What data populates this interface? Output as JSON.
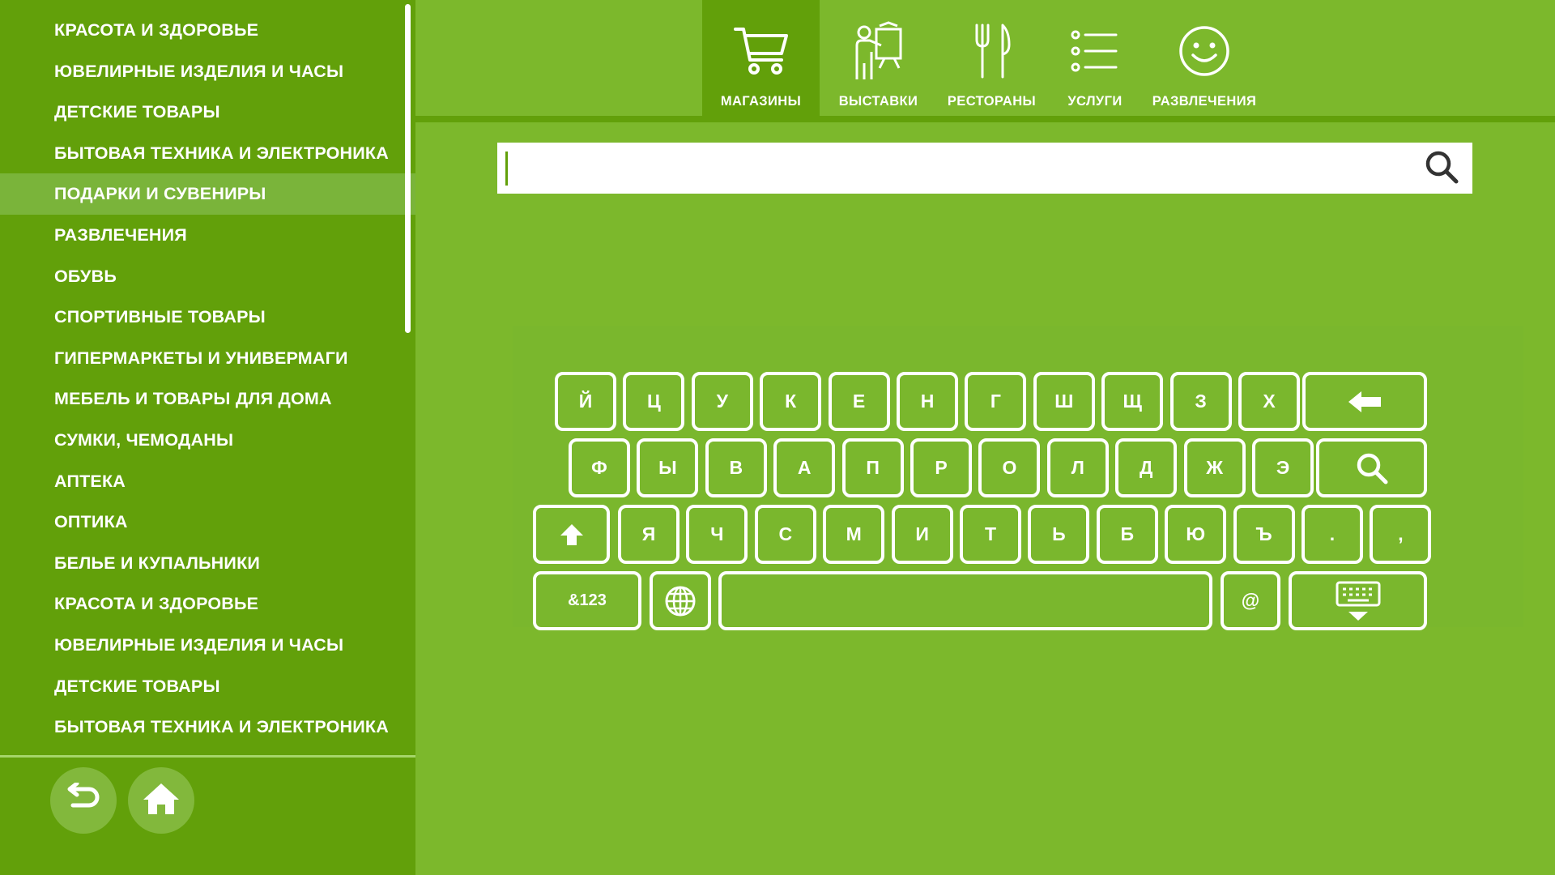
{
  "sidebar": {
    "categories": [
      "КРАСОТА И ЗДОРОВЬЕ",
      "ЮВЕЛИРНЫЕ ИЗДЕЛИЯ И ЧАСЫ",
      "ДЕТСКИЕ ТОВАРЫ",
      "БЫТОВАЯ ТЕХНИКА И ЭЛЕКТРОНИКА",
      "ПОДАРКИ И СУВЕНИРЫ",
      "РАЗВЛЕЧЕНИЯ",
      "ОБУВЬ",
      "СПОРТИВНЫЕ ТОВАРЫ",
      "ГИПЕРМАРКЕТЫ И УНИВЕРМАГИ",
      "МЕБЕЛЬ И ТОВАРЫ ДЛЯ ДОМА",
      "СУМКИ, ЧЕМОДАНЫ",
      "АПТЕКА",
      "ОПТИКА",
      "БЕЛЬЕ И КУПАЛЬНИКИ",
      "КРАСОТА И ЗДОРОВЬЕ",
      "ЮВЕЛИРНЫЕ ИЗДЕЛИЯ И ЧАСЫ",
      "ДЕТСКИЕ ТОВАРЫ",
      "БЫТОВАЯ ТЕХНИКА И ЭЛЕКТРОНИКА"
    ],
    "active_index": 4,
    "buttons": {
      "back_icon": "undo-arrow-icon",
      "home_icon": "home-icon"
    }
  },
  "nav": {
    "items": [
      {
        "label": "МАГАЗИНЫ",
        "icon": "cart-icon",
        "active": true
      },
      {
        "label": "ВЫСТАВКИ",
        "icon": "exhibition-icon",
        "active": false
      },
      {
        "label": "РЕСТОРАНЫ",
        "icon": "fork-knife-icon",
        "active": false
      },
      {
        "label": "УСЛУГИ",
        "icon": "list-icon",
        "active": false
      },
      {
        "label": "РАЗВЛЕЧЕНИЯ",
        "icon": "smiley-icon",
        "active": false
      }
    ]
  },
  "search": {
    "value": "",
    "placeholder": "",
    "icon": "search-icon"
  },
  "keyboard": {
    "row1": [
      "Й",
      "Ц",
      "У",
      "К",
      "Е",
      "Н",
      "Г",
      "Ш",
      "Щ",
      "З",
      "Х"
    ],
    "row2": [
      "Ф",
      "Ы",
      "В",
      "А",
      "П",
      "Р",
      "О",
      "Л",
      "Д",
      "Ж",
      "Э"
    ],
    "row3": [
      "Я",
      "Ч",
      "С",
      "М",
      "И",
      "Т",
      "Ь",
      "Б",
      "Ю",
      "Ъ",
      ".",
      ","
    ],
    "row4": {
      "symbols": "&123",
      "at": "@"
    },
    "icons": {
      "backspace": "backspace-arrow-icon",
      "search": "search-icon",
      "shift": "shift-arrow-icon",
      "language": "globe-icon",
      "hide": "keyboard-hide-icon"
    }
  },
  "colors": {
    "background": "#7cb82c",
    "sidebar": "#62a00a",
    "active_item": "#7ab43a",
    "white": "#ffffff"
  }
}
